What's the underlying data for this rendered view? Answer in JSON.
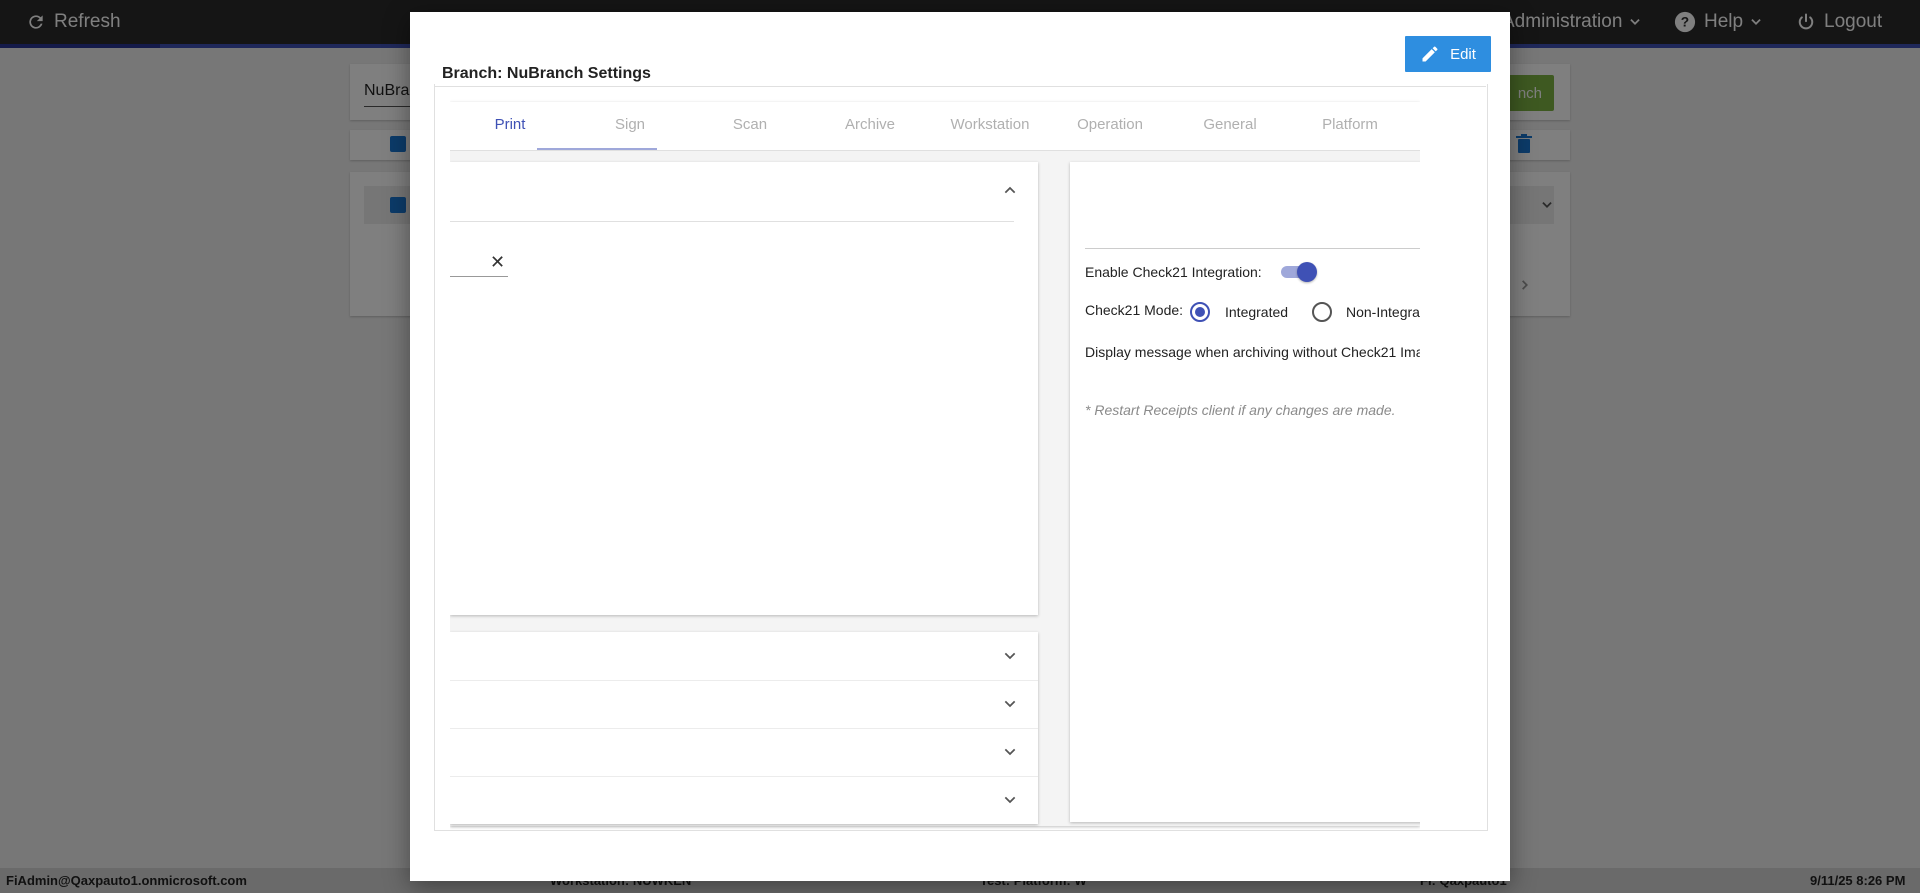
{
  "topbar": {
    "refresh_label": "Refresh",
    "administration_label": "Administration",
    "help_label": "Help",
    "logout_label": "Logout"
  },
  "background": {
    "search_value": "NuBra",
    "add_button_label": "nch"
  },
  "modal": {
    "title": "Branch: NuBranch Settings",
    "edit_label": "Edit",
    "tabs": [
      {
        "label": "Print",
        "active": true
      },
      {
        "label": "Sign",
        "active": false
      },
      {
        "label": "Scan",
        "active": false
      },
      {
        "label": "Archive",
        "active": false
      },
      {
        "label": "Workstation",
        "active": false
      },
      {
        "label": "Operation",
        "active": false
      },
      {
        "label": "General",
        "active": false
      },
      {
        "label": "Platform",
        "active": false
      }
    ],
    "right_panel": {
      "enable_check21_label": "Enable Check21 Integration:",
      "enable_check21_value": true,
      "mode_label": "Check21 Mode:",
      "mode_options": [
        "Integrated",
        "Non-Integra"
      ],
      "mode_selected": "Integrated",
      "display_message_label": "Display message when archiving without Check21 Ima",
      "restart_note": "* Restart Receipts client if any changes are made."
    },
    "clear_icon": "close-icon"
  },
  "statusbar": {
    "user": "FiAdmin@Qaxpauto1.onmicrosoft.com",
    "workstation": "Workstation: NUWKEN",
    "platform": "Test: Platform: W",
    "fi": "FI: Qaxpauto1",
    "datetime": "9/11/25 8:26 PM"
  },
  "colors": {
    "accent": "#3f51b5",
    "edit_button": "#2e8ee0",
    "topbar": "#2b2b2b",
    "add_button": "#7cb342"
  }
}
